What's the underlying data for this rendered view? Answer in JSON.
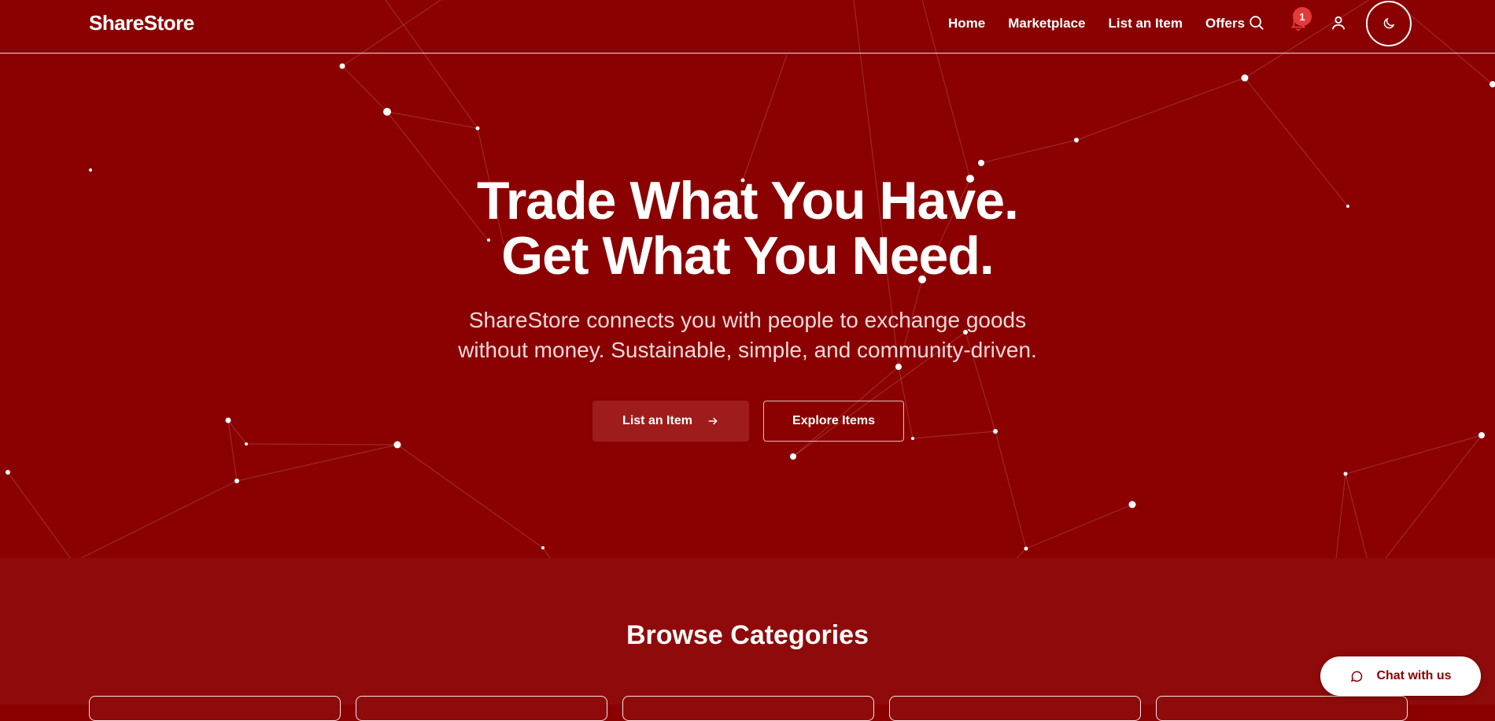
{
  "navbar": {
    "brand": "ShareStore",
    "links": [
      "Home",
      "Marketplace",
      "List an Item",
      "Offers"
    ],
    "icons": [
      "search-icon",
      "bell-icon",
      "user-icon",
      "moon-icon"
    ],
    "notification_count": "1"
  },
  "hero": {
    "title_line1": "Trade What You Have.",
    "title_line2": "Get What You Need.",
    "subtitle_line1": "ShareStore connects you with people to exchange goods",
    "subtitle_line2": "without money. Sustainable, simple, and community-driven.",
    "primary_button": "List an Item",
    "secondary_button": "Explore Items"
  },
  "categories": {
    "title": "Browse Categories",
    "card_count": 5
  },
  "chat": {
    "label": "Chat with us"
  },
  "colors": {
    "background": "#8b0000",
    "section": "#8f0b0b",
    "badge": "#e33b3b",
    "button": "#9f1c1c"
  }
}
